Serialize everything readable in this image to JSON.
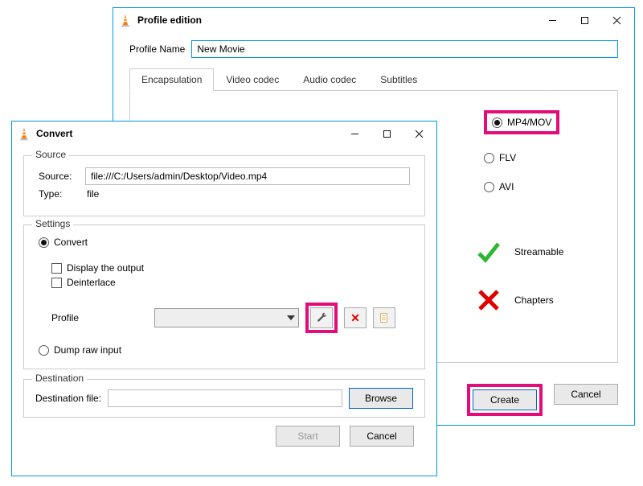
{
  "profile_window": {
    "title": "Profile edition",
    "name_label": "Profile Name",
    "name_value": "New Movie",
    "tabs": {
      "encapsulation": "Encapsulation",
      "video_codec": "Video codec",
      "audio_codec": "Audio codec",
      "subtitles": "Subtitles"
    },
    "formats": {
      "mp4": "MP4/MOV",
      "flv": "FLV",
      "avi": "AVI"
    },
    "indicators": {
      "streamable": "Streamable",
      "chapters": "Chapters"
    },
    "buttons": {
      "create": "Create",
      "cancel": "Cancel"
    }
  },
  "convert_window": {
    "title": "Convert",
    "source": {
      "group": "Source",
      "source_label": "Source:",
      "source_value": "file:///C:/Users/admin/Desktop/Video.mp4",
      "type_label": "Type:",
      "type_value": "file"
    },
    "settings": {
      "group": "Settings",
      "convert": "Convert",
      "display_output": "Display the output",
      "deinterlace": "Deinterlace",
      "profile_label": "Profile",
      "dump_raw": "Dump raw input"
    },
    "destination": {
      "group": "Destination",
      "label": "Destination file:",
      "value": "",
      "browse": "Browse"
    },
    "buttons": {
      "start": "Start",
      "cancel": "Cancel"
    }
  }
}
